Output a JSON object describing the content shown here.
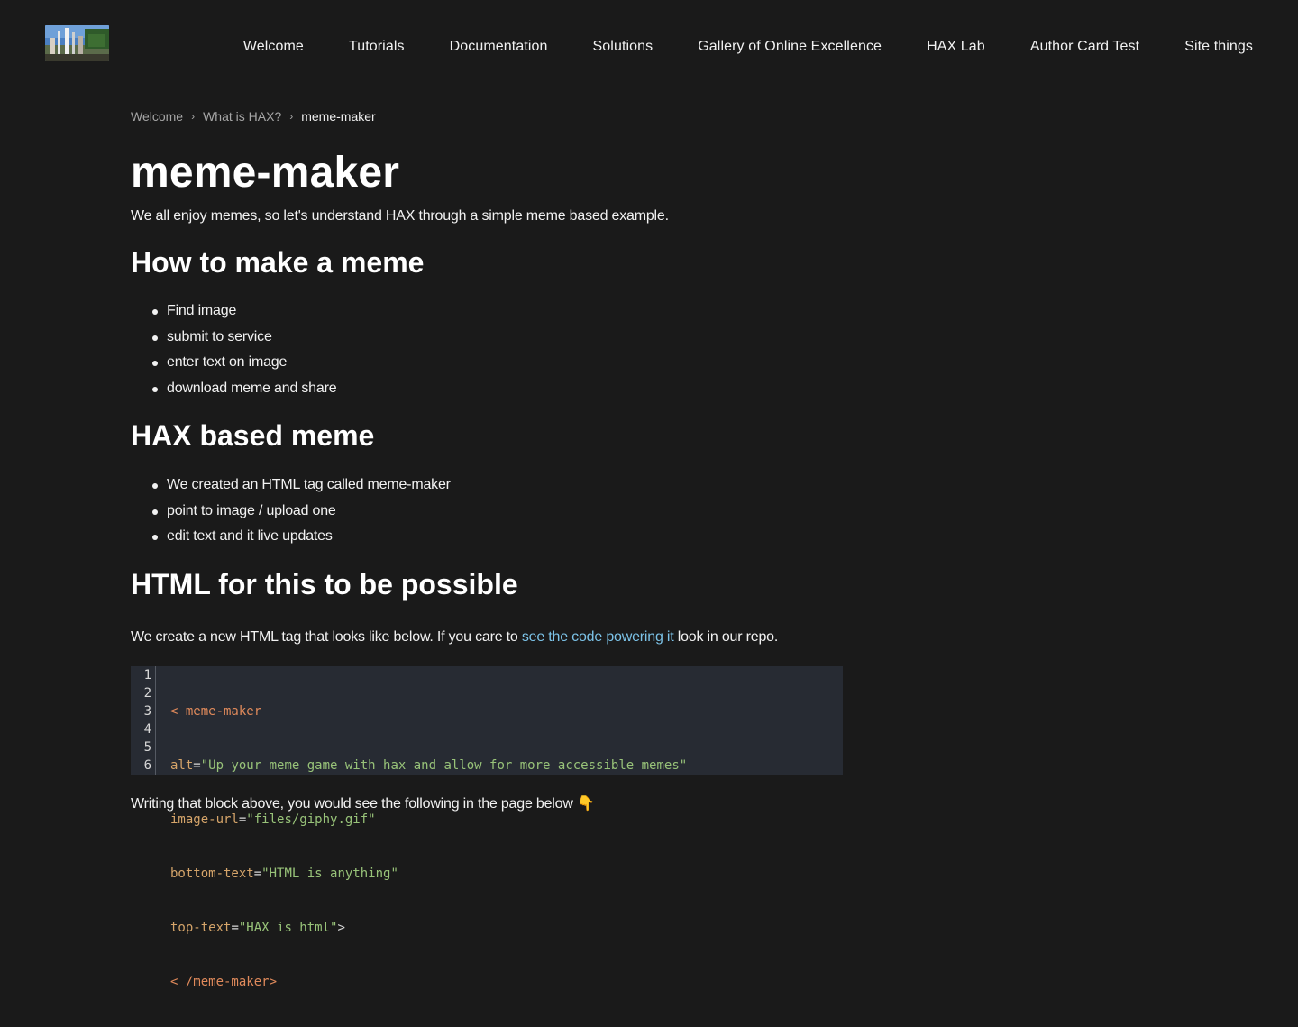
{
  "header": {
    "logo_alt": "site logo",
    "nav": [
      {
        "label": "Welcome"
      },
      {
        "label": "Tutorials"
      },
      {
        "label": "Documentation"
      },
      {
        "label": "Solutions"
      },
      {
        "label": "Gallery of Online Excellence"
      },
      {
        "label": "HAX Lab"
      },
      {
        "label": "Author Card Test"
      },
      {
        "label": "Site things"
      }
    ]
  },
  "breadcrumb": {
    "items": [
      "Welcome",
      "What is HAX?"
    ],
    "current": "meme-maker",
    "separator": "›"
  },
  "page": {
    "title": "meme-maker",
    "intro": "We all enjoy memes, so let's understand HAX through a simple meme based example.",
    "section1": {
      "heading": "How to make a meme",
      "items": [
        "Find image",
        "submit to service",
        "enter text on image",
        "download meme and share"
      ]
    },
    "section2": {
      "heading": "HAX based meme",
      "items": [
        "We created an HTML tag called meme-maker",
        "point to image / upload one",
        "edit text and it live updates"
      ]
    },
    "section3": {
      "heading": "HTML for this to be possible",
      "text_before": "We create a new HTML tag that looks like below. If you care to ",
      "link": "see the code powering it",
      "text_after": " look in our repo."
    },
    "code": {
      "line_numbers": [
        "1",
        "2",
        "3",
        "4",
        "5",
        "6"
      ],
      "line1": {
        "tag": "< meme-maker"
      },
      "line2": {
        "attr": "alt",
        "eq": "=",
        "val": "\"Up your meme game with hax and allow for more accessible memes\""
      },
      "line3": {
        "attr": "image-url",
        "eq": "=",
        "val": "\"files/giphy.gif\""
      },
      "line4": {
        "attr": "bottom-text",
        "eq": "=",
        "val": "\"HTML is anything\""
      },
      "line5": {
        "attr": "top-text",
        "eq": "=",
        "val": "\"HAX is html\"",
        "close": ">"
      },
      "line6": {
        "tag": "< /meme-maker>"
      }
    },
    "after_code": "Writing that block above, you would see the following in the page below 👇"
  },
  "colors": {
    "background": "#1a1a1a",
    "link": "#7cc3e8",
    "code_background": "#272b33"
  }
}
